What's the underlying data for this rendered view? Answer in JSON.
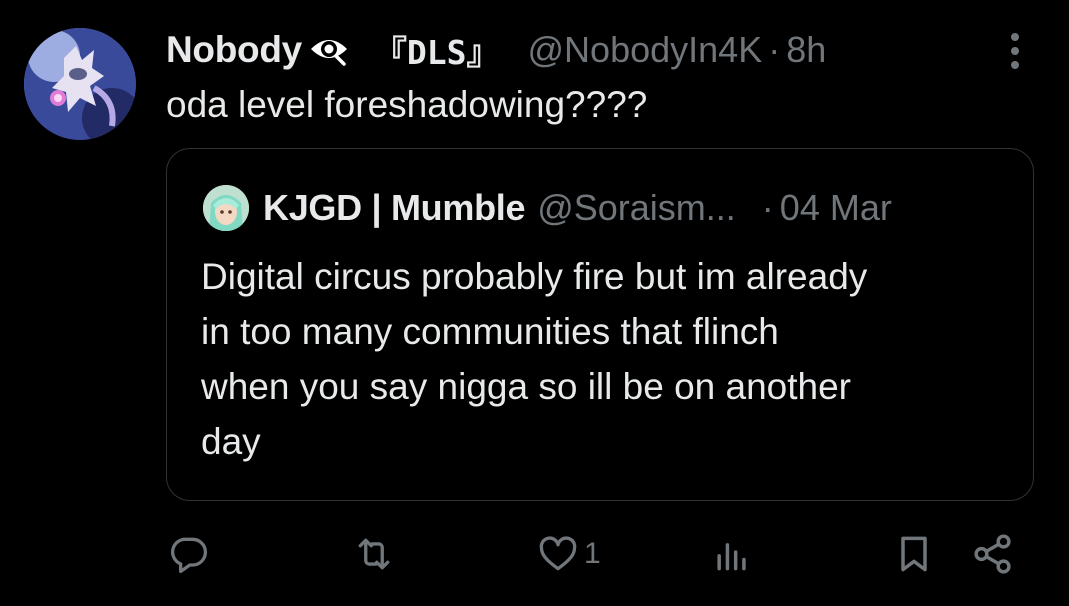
{
  "post": {
    "author": {
      "display_name": "Nobody",
      "badge_icon": "eye-icon",
      "tag": "『DLS』",
      "handle": "@NobodyIn4K",
      "separator": "·",
      "time": "8h"
    },
    "text": "oda level foreshadowing????",
    "more_icon": "more-vertical-icon"
  },
  "quote": {
    "author": {
      "display_name": "KJGD | Mumble",
      "handle": "@Soraism...",
      "separator": "·",
      "time": "04 Mar"
    },
    "text": "Digital circus probably fire but im already\nin too many communities that flinch\nwhen you say nigga so ill be on another\nday"
  },
  "actions": {
    "reply": {
      "icon": "reply-icon",
      "count": ""
    },
    "repost": {
      "icon": "repost-icon",
      "count": ""
    },
    "like": {
      "icon": "heart-icon",
      "count": "1"
    },
    "views": {
      "icon": "analytics-icon",
      "count": ""
    },
    "bookmark": {
      "icon": "bookmark-icon"
    },
    "share": {
      "icon": "share-icon"
    }
  },
  "colors": {
    "background": "#000000",
    "text_primary": "#e7e9ea",
    "text_secondary": "#71767b",
    "border": "#2f3336"
  }
}
